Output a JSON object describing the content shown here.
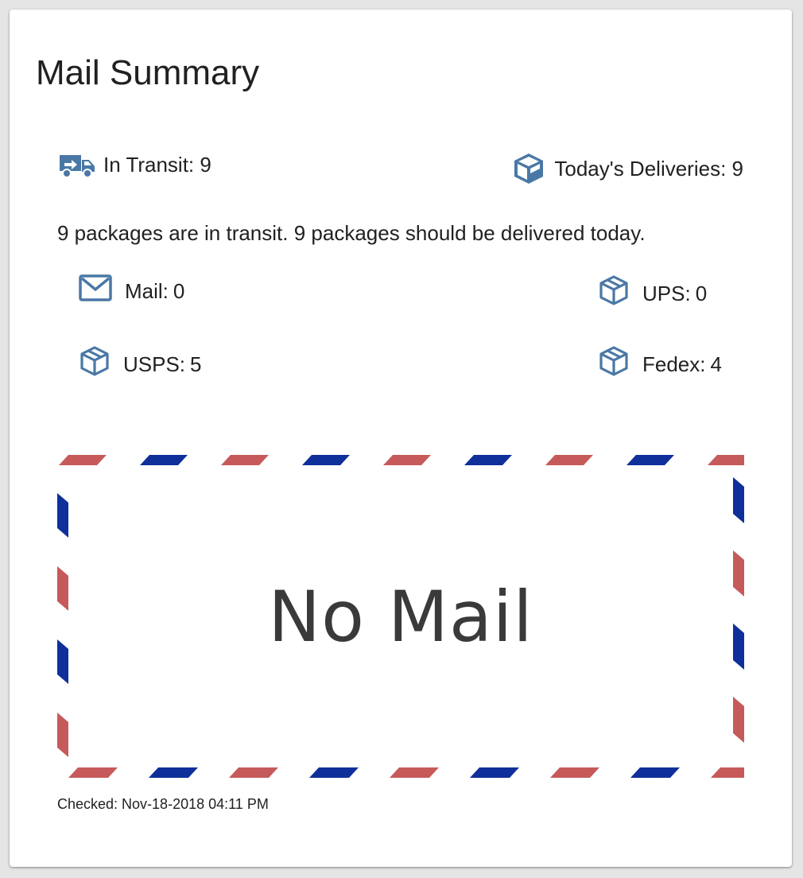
{
  "title": "Mail Summary",
  "stats": {
    "in_transit_label": "In Transit:",
    "in_transit_value": "9",
    "today_label": "Today's Deliveries:",
    "today_value": "9"
  },
  "summary": "9 packages are in transit. 9 packages should be delivered today.",
  "carriers": {
    "mail": {
      "label": "Mail:",
      "value": "0",
      "icon": "envelope-icon"
    },
    "ups": {
      "label": "UPS:",
      "value": "0",
      "icon": "package-icon"
    },
    "usps": {
      "label": "USPS:",
      "value": "5",
      "icon": "package-icon"
    },
    "fedex": {
      "label": "Fedex:",
      "value": "4",
      "icon": "package-icon"
    }
  },
  "mail_image": {
    "text": "No Mail",
    "stripe_red": "#c65a5a",
    "stripe_blue": "#0f2f9a"
  },
  "checked": "Checked: Nov-18-2018 04:11 PM",
  "colors": {
    "icon": "#4a78a6",
    "text": "#212121",
    "card": "#ffffff",
    "page_bg": "#e5e5e5"
  }
}
